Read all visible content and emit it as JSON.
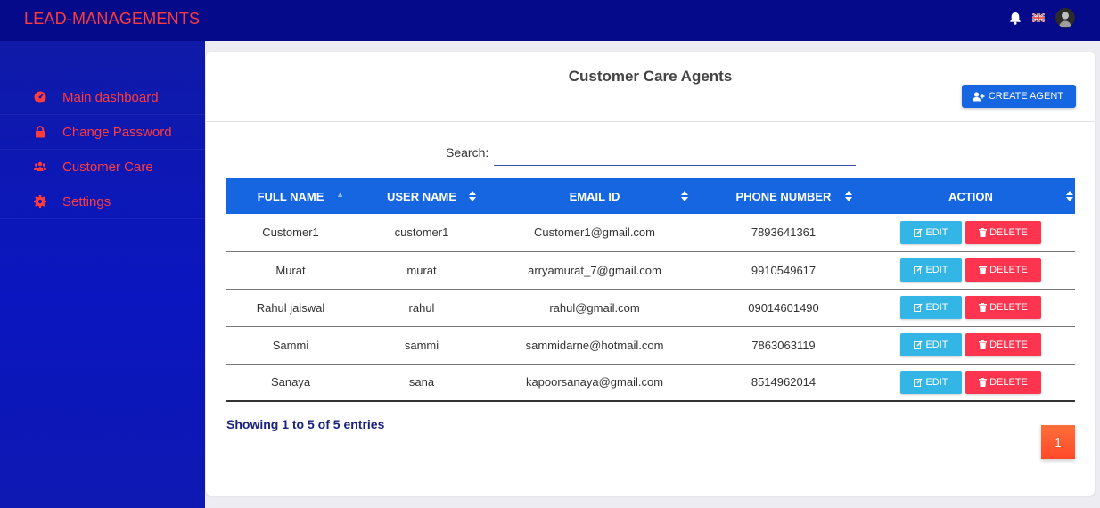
{
  "brand": "LEAD-MANAGEMENTS",
  "topbar": {
    "icons": [
      "bell-icon",
      "uk-flag-icon",
      "user-avatar"
    ]
  },
  "sidebar": {
    "items": [
      {
        "label": "Main dashboard",
        "icon": "dashboard-icon"
      },
      {
        "label": "Change Password",
        "icon": "lock-icon"
      },
      {
        "label": "Customer Care",
        "icon": "users-icon"
      },
      {
        "label": "Settings",
        "icon": "gear-icon"
      }
    ]
  },
  "page": {
    "title": "Customer Care Agents",
    "create_label": "CREATE AGENT",
    "search_label": "Search:",
    "search_value": ""
  },
  "table": {
    "headers": [
      "FULL NAME",
      "USER NAME",
      "EMAIL ID",
      "PHONE NUMBER",
      "ACTION"
    ],
    "edit_label": "EDIT",
    "delete_label": "DELETE",
    "rows": [
      [
        "Customer1",
        "customer1",
        "Customer1@gmail.com",
        "7893641361"
      ],
      [
        "Murat",
        "murat",
        "arryamurat_7@gmail.com",
        "9910549617"
      ],
      [
        "Rahul jaiswal",
        "rahul",
        "rahul@gmail.com",
        "09014601490"
      ],
      [
        "Sammi",
        "sammi",
        "sammidarne@hotmail.com",
        "7863063119"
      ],
      [
        "Sanaya",
        "sana",
        "kapoorsanaya@gmail.com",
        "8514962014"
      ]
    ]
  },
  "footer": {
    "info": "Showing 1 to 5 of 5 entries",
    "current_page": "1"
  },
  "colors": {
    "topbar": "#050a8a",
    "sidebar": "#0b16c0",
    "brand": "#ff3b3b",
    "primary": "#1566e0",
    "edit": "#33b5e5",
    "delete": "#ff3550",
    "page_active": "#ff5a30"
  }
}
